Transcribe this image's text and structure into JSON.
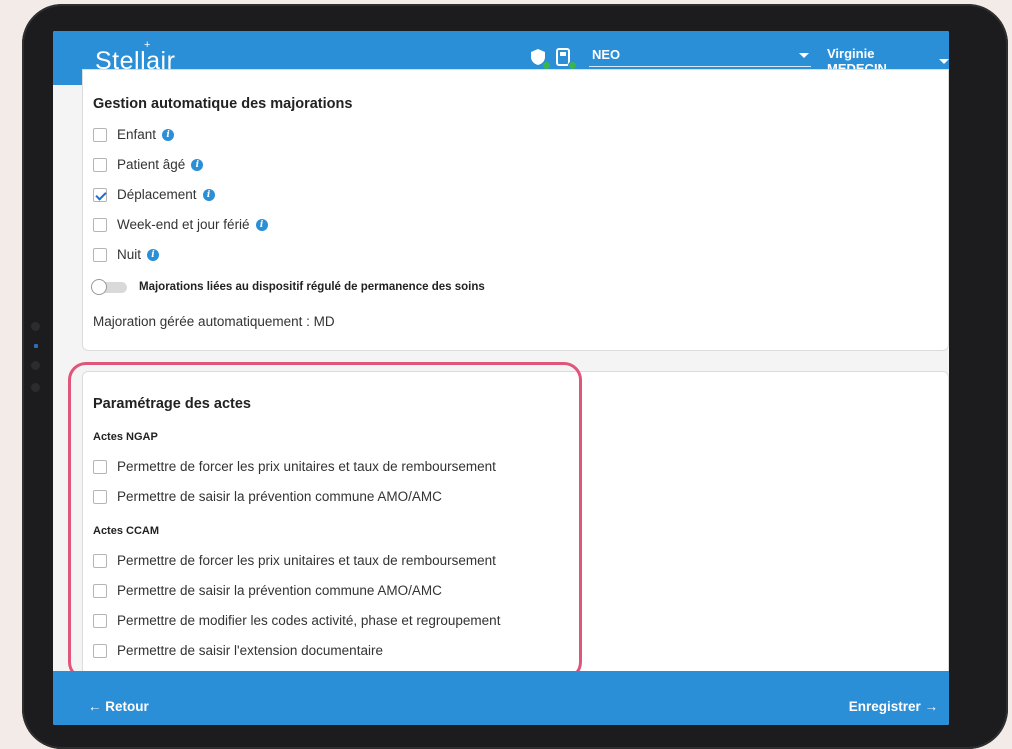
{
  "header": {
    "logo": "Stellair",
    "logo_star": "+",
    "device_select": "NEO",
    "user_name": "Virginie MEDECIN"
  },
  "majorations": {
    "title": "Gestion automatique des majorations",
    "options": [
      {
        "label": "Enfant",
        "checked": false
      },
      {
        "label": "Patient âgé",
        "checked": false
      },
      {
        "label": "Déplacement",
        "checked": true
      },
      {
        "label": "Week-end et jour férié",
        "checked": false
      },
      {
        "label": "Nuit",
        "checked": false
      }
    ],
    "toggle_label": "Majorations liées au dispositif régulé de permanence des soins",
    "toggle_on": false,
    "auto_text": "Majoration gérée automatiquement : MD"
  },
  "actes": {
    "title": "Paramétrage des actes",
    "ngap_title": "Actes NGAP",
    "ngap_options": [
      {
        "label": "Permettre de forcer les prix unitaires et taux de remboursement",
        "checked": false
      },
      {
        "label": "Permettre de saisir la prévention commune AMO/AMC",
        "checked": false
      }
    ],
    "ccam_title": "Actes CCAM",
    "ccam_options": [
      {
        "label": "Permettre de forcer les prix unitaires et taux de remboursement",
        "checked": false
      },
      {
        "label": "Permettre de saisir la prévention commune AMO/AMC",
        "checked": false
      },
      {
        "label": "Permettre de modifier les codes activité, phase et regroupement",
        "checked": false
      },
      {
        "label": "Permettre de saisir l'extension documentaire",
        "checked": false
      }
    ]
  },
  "footer": {
    "back_label": "← Retour",
    "save_label": "Enregistrer →"
  },
  "colors": {
    "brand": "#2b8fd7",
    "highlight": "#e0557a",
    "status_ok": "#3ab54a"
  }
}
